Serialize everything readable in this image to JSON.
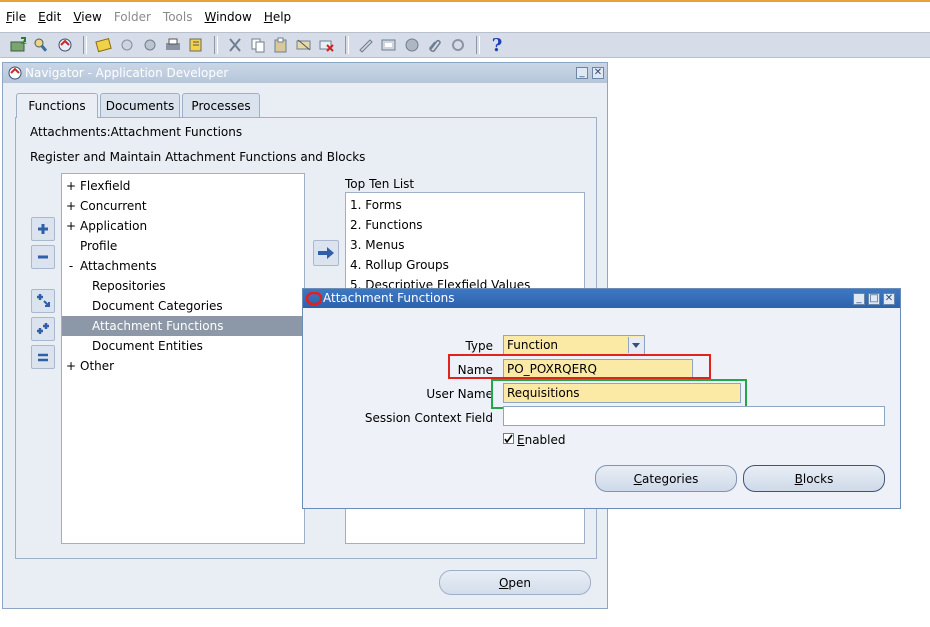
{
  "menubar": {
    "items": [
      {
        "label": "File",
        "accel": "F",
        "rest": "ile",
        "enabled": true
      },
      {
        "label": "Edit",
        "accel": "E",
        "rest": "dit",
        "enabled": true
      },
      {
        "label": "View",
        "accel": "V",
        "rest": "iew",
        "enabled": true
      },
      {
        "label": "Folder",
        "accel": "",
        "rest": "Folder",
        "enabled": false
      },
      {
        "label": "Tools",
        "accel": "",
        "rest": "Tools",
        "enabled": false
      },
      {
        "label": "Window",
        "accel": "W",
        "rest": "indow",
        "enabled": true
      },
      {
        "label": "Help",
        "accel": "H",
        "rest": "elp",
        "enabled": true
      }
    ]
  },
  "toolbar": {
    "help_glyph": "?"
  },
  "navigator": {
    "title": "Navigator - Application Developer",
    "tabs": [
      "Functions",
      "Documents",
      "Processes"
    ],
    "breadcrumb": "Attachments:Attachment Functions",
    "description": "Register and Maintain Attachment Functions and Blocks",
    "tree": [
      {
        "prefix": "+",
        "label": "Flexfield",
        "indent": 0,
        "selected": false
      },
      {
        "prefix": "+",
        "label": "Concurrent",
        "indent": 0,
        "selected": false
      },
      {
        "prefix": "+",
        "label": "Application",
        "indent": 0,
        "selected": false
      },
      {
        "prefix": "",
        "label": "Profile",
        "indent": 0,
        "selected": false
      },
      {
        "prefix": "-",
        "label": "Attachments",
        "indent": 0,
        "selected": false
      },
      {
        "prefix": "",
        "label": "Repositories",
        "indent": 1,
        "selected": false
      },
      {
        "prefix": "",
        "label": "Document Categories",
        "indent": 1,
        "selected": false
      },
      {
        "prefix": "",
        "label": "Attachment Functions",
        "indent": 1,
        "selected": true
      },
      {
        "prefix": "",
        "label": "Document Entities",
        "indent": 1,
        "selected": false
      },
      {
        "prefix": "+",
        "label": "Other",
        "indent": 0,
        "selected": false
      }
    ],
    "top_ten_label": "Top Ten List",
    "top_ten": [
      "1. Forms",
      "2. Functions",
      "3. Menus",
      "4. Rollup Groups",
      "5. Descriptive Flexfield Values"
    ],
    "open_button": {
      "accel": "O",
      "rest": "pen"
    }
  },
  "attachment_dialog": {
    "title": "Attachment Functions",
    "type_label": "Type",
    "type_value": "Function",
    "name_label": "Name",
    "name_value": "PO_POXRQERQ",
    "user_name_label": "User Name",
    "user_name_value": "Requisitions",
    "session_context_label": "Session Context Field",
    "session_context_value": "",
    "enabled_label_accel": "E",
    "enabled_label_rest": "nabled",
    "enabled_checked": true,
    "categories_button": {
      "accel": "C",
      "rest": "ategories"
    },
    "blocks_button": {
      "accel": "B",
      "rest": "locks"
    }
  },
  "highlight_colors": {
    "name_box": "#e0231c",
    "user_name_box": "#22a84a"
  }
}
